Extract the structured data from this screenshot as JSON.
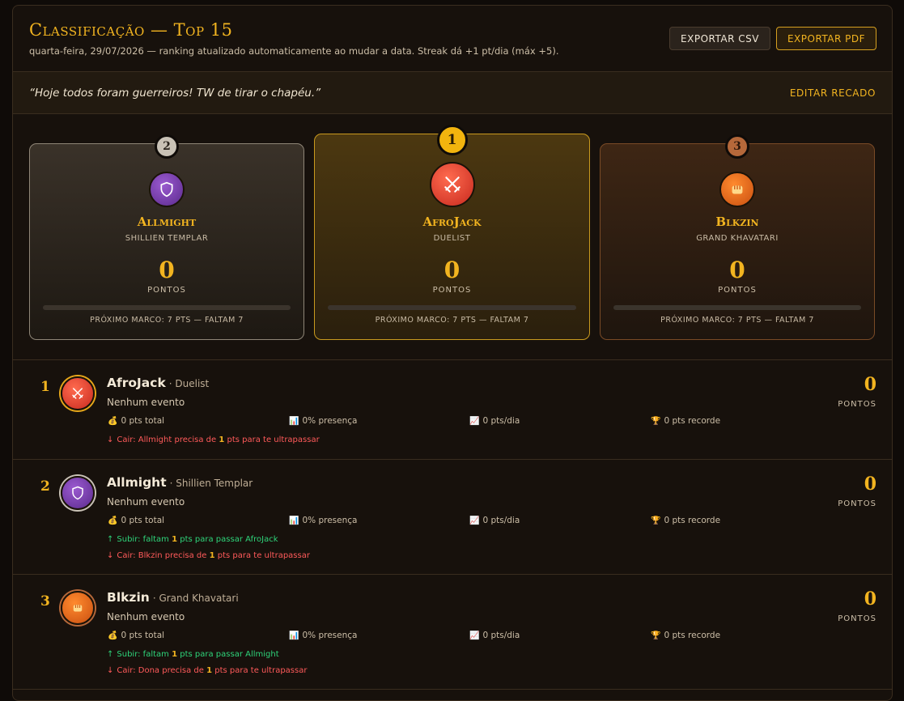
{
  "header": {
    "title": "Classificação — Top 15",
    "subtitle": "quarta-feira, 29/07/2026 — ranking atualizado automaticamente ao mudar a data. Streak dá +1 pt/dia (máx +5).",
    "export_csv": "EXPORTAR CSV",
    "export_pdf": "EXPORTAR PDF"
  },
  "notice": {
    "quote": "“Hoje todos foram guerreiros! TW de tirar o chapéu.”",
    "edit_label": "EDITAR RECADO"
  },
  "podium": [
    {
      "rank": "2",
      "name": "Allmight",
      "class": "SHILLIEN TEMPLAR",
      "points": "0",
      "points_label": "PONTOS",
      "progress": 0,
      "milestone": "PRÓXIMO MARCO: 7 PTS — FALTAM 7",
      "icon": "shield-icon"
    },
    {
      "rank": "1",
      "name": "AfroJack",
      "class": "DUELIST",
      "points": "0",
      "points_label": "PONTOS",
      "progress": 0,
      "milestone": "PRÓXIMO MARCO: 7 PTS — FALTAM 7",
      "icon": "crossed-swords-icon"
    },
    {
      "rank": "3",
      "name": "Blkzin",
      "class": "GRAND KHAVATARI",
      "points": "0",
      "points_label": "PONTOS",
      "progress": 0,
      "milestone": "PRÓXIMO MARCO: 7 PTS — FALTAM 7",
      "icon": "fist-icon"
    }
  ],
  "rows": [
    {
      "rank": "1",
      "name": "AfroJack",
      "class": "· Duelist",
      "event": "Nenhum evento",
      "stats": [
        "0 pts total",
        "0% presença",
        "0 pts/dia",
        "0 pts recorde"
      ],
      "up": null,
      "down": {
        "a": "Cair: Allmight precisa de ",
        "n": "1",
        "b": " pts para te ultrapassar"
      },
      "points": "0",
      "points_label": "PONTOS"
    },
    {
      "rank": "2",
      "name": "Allmight",
      "class": "· Shillien Templar",
      "event": "Nenhum evento",
      "stats": [
        "0 pts total",
        "0% presença",
        "0 pts/dia",
        "0 pts recorde"
      ],
      "up": {
        "a": "Subir: faltam ",
        "n": "1",
        "b": " pts para passar AfroJack"
      },
      "down": {
        "a": "Cair: Blkzin precisa de ",
        "n": "1",
        "b": " pts para te ultrapassar"
      },
      "points": "0",
      "points_label": "PONTOS"
    },
    {
      "rank": "3",
      "name": "Blkzin",
      "class": "· Grand Khavatari",
      "event": "Nenhum evento",
      "stats": [
        "0 pts total",
        "0% presença",
        "0 pts/dia",
        "0 pts recorde"
      ],
      "up": {
        "a": "Subir: faltam ",
        "n": "1",
        "b": " pts para passar Allmight"
      },
      "down": {
        "a": "Cair: Dona precisa de ",
        "n": "1",
        "b": " pts para te ultrapassar"
      },
      "points": "0",
      "points_label": "PONTOS"
    }
  ],
  "colors": {
    "accent": "#f2b420",
    "up": "#2ed47a",
    "down": "#ff5a5a",
    "background": "#17110c"
  }
}
